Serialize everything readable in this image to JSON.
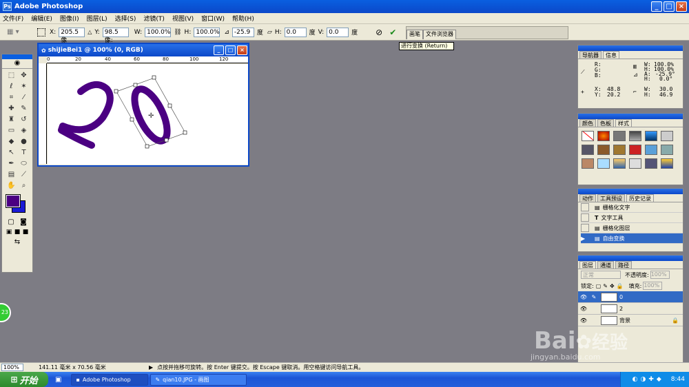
{
  "app": {
    "title": "Adobe Photoshop"
  },
  "menu": [
    "文件(F)",
    "编辑(E)",
    "图像(I)",
    "图层(L)",
    "选择(S)",
    "滤镜(T)",
    "视图(V)",
    "窗口(W)",
    "帮助(H)"
  ],
  "options": {
    "x_label": "X:",
    "x_value": "205.5 像",
    "y_label": "Y:",
    "y_value": "98.5 像:",
    "w_label": "W:",
    "w_value": "100.0%",
    "h_label": "H:",
    "h_value": "100.0%",
    "angle_value": "-25.9",
    "angle_unit": "度",
    "hskew_label": "H:",
    "hskew_value": "0.0",
    "hskew_unit": "度",
    "vskew_label": "V:",
    "vskew_value": "0.0",
    "vskew_unit": "度"
  },
  "palette_well": {
    "tabs": [
      "画笔",
      "文件浏览器"
    ]
  },
  "tooltip": "进行变换 (Return)",
  "document": {
    "title": "shiJieBei1 @ 100% (0, RGB)",
    "ruler_marks": [
      "0",
      "20",
      "40",
      "60",
      "80",
      "100",
      "120"
    ],
    "canvas_text": "20",
    "text_color": "#4b0082"
  },
  "navigator": {
    "tabs": [
      "导航器",
      "信息"
    ],
    "r_label": "R:",
    "g_label": "G:",
    "b_label": "B:",
    "w1_label": "W:",
    "w1_value": "100.0%",
    "h1_label": "H:",
    "h1_value": "100.0%",
    "a_label": "A:",
    "a_value": "-25.9°",
    "skew_label": "H:",
    "skew_value": "0.0°",
    "x_label": "X:",
    "x_value": "48.8",
    "y_label": "Y:",
    "y_value": "20.2",
    "w2_label": "W:",
    "w2_value": "30.0",
    "h2_label": "H:",
    "h2_value": "46.9"
  },
  "swatches": {
    "tabs": [
      "颜色",
      "色板",
      "样式"
    ]
  },
  "history": {
    "tabs": [
      "动作",
      "工具预设",
      "历史记录"
    ],
    "items": [
      "栅格化文字",
      "文字工具",
      "栅格化图层",
      "自由变换"
    ]
  },
  "layers": {
    "tabs": [
      "图层",
      "通道",
      "路径"
    ],
    "blend_mode": "正常",
    "opacity_label": "不透明度:",
    "opacity_value": "100%",
    "lock_label": "锁定:",
    "fill_label": "填充:",
    "fill_value": "100%",
    "items": [
      "0",
      "2",
      "背景"
    ]
  },
  "status": {
    "zoom": "100%",
    "doc_size": "141.11 毫米 x 70.56 毫米",
    "hint": "点按并拖移可旋转。按 Enter 键提交。按 Escape 键取消。用空格键访问导航工具。"
  },
  "taskbar": {
    "start": "开始",
    "tasks": [
      "Adobe Photoshop",
      "qian10.JPG - 画图"
    ],
    "clock": "8:44",
    "badge": "23"
  },
  "watermark": {
    "brand": "Bai",
    "brand2": "经验",
    "url": "jingyan.baidu.com"
  },
  "colors": {
    "foreground": "#4b0082",
    "background": "#1a1ad6",
    "xp_blue": "#0b48c9"
  }
}
